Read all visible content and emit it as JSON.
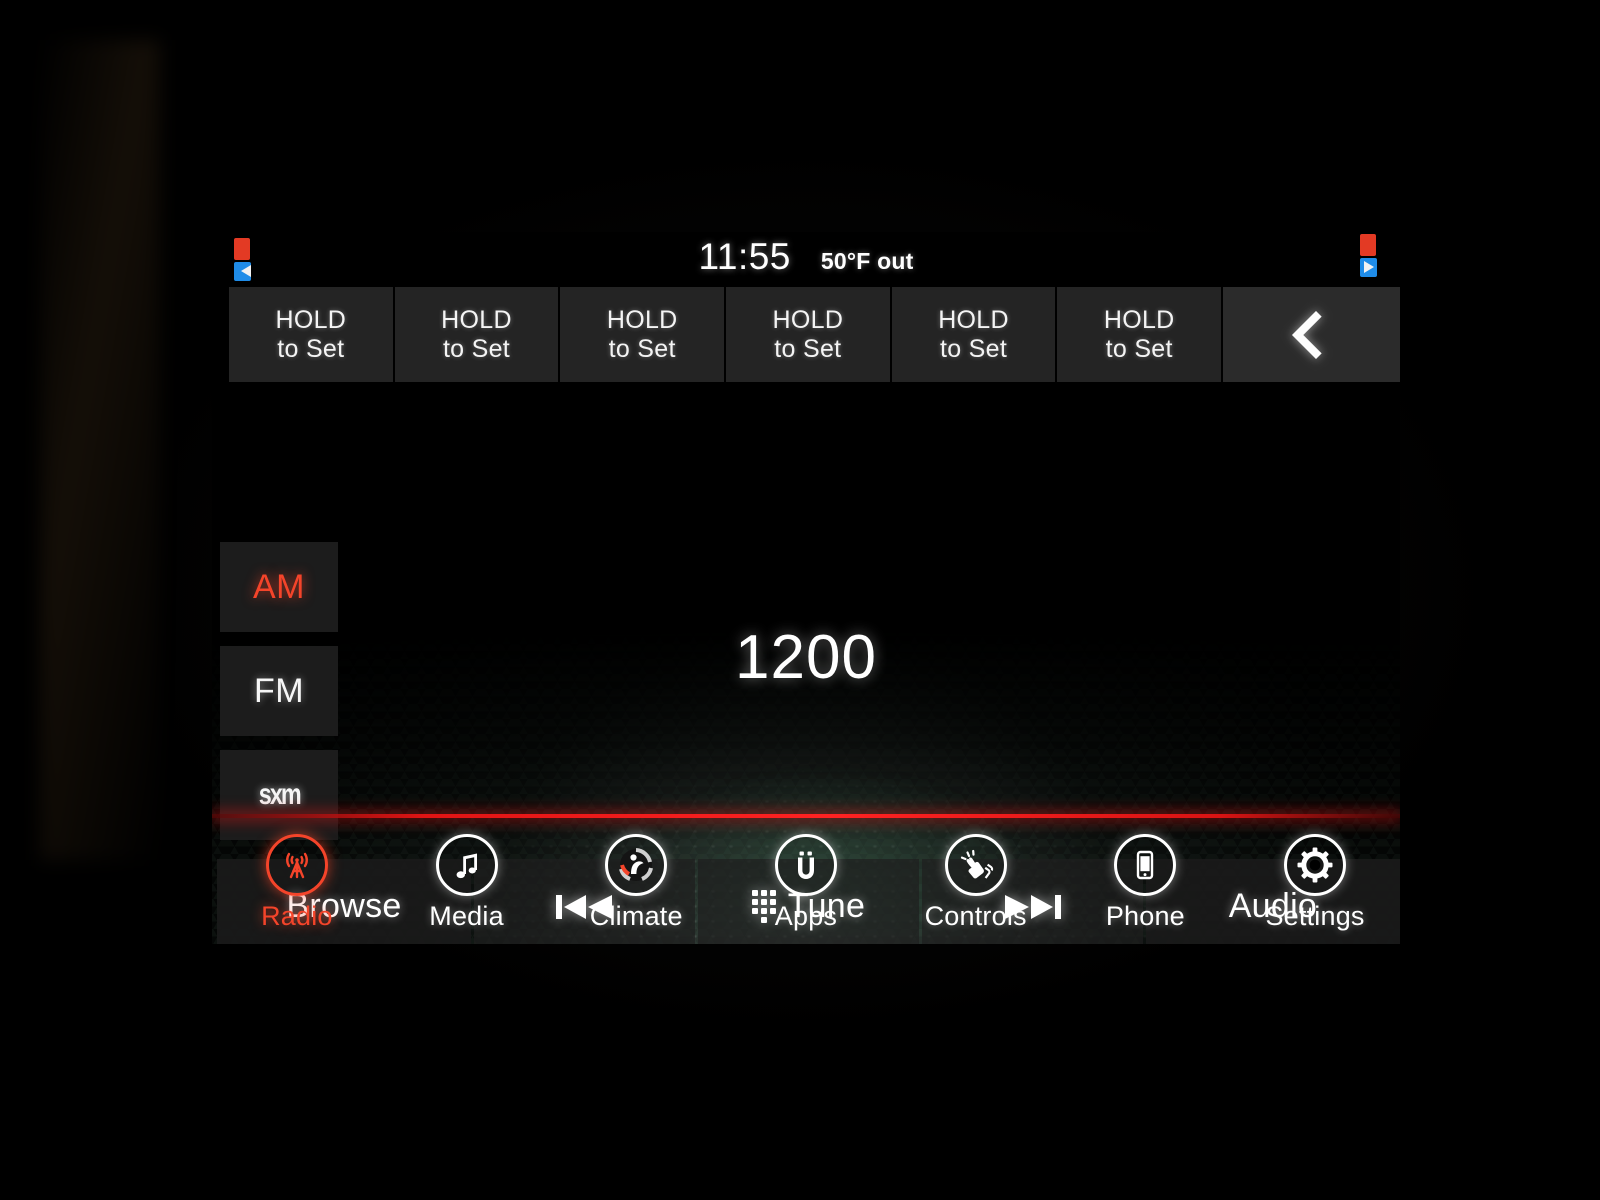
{
  "statusbar": {
    "clock": "11:55",
    "temperature": "50°F out",
    "left_icon": "media-indicator-icon",
    "right_icon": "media-indicator-icon"
  },
  "presets": {
    "buttons": [
      {
        "line1": "HOLD",
        "line2": "to Set"
      },
      {
        "line1": "HOLD",
        "line2": "to Set"
      },
      {
        "line1": "HOLD",
        "line2": "to Set"
      },
      {
        "line1": "HOLD",
        "line2": "to Set"
      },
      {
        "line1": "HOLD",
        "line2": "to Set"
      },
      {
        "line1": "HOLD",
        "line2": "to Set"
      }
    ],
    "back_icon": "chevron-left-icon"
  },
  "bands": {
    "items": [
      {
        "label": "AM",
        "active": true
      },
      {
        "label": "FM",
        "active": false
      },
      {
        "label": "sxm",
        "active": false
      }
    ],
    "active_color": "#f4442a"
  },
  "now_playing": {
    "frequency": "1200"
  },
  "transport": {
    "browse_label": "Browse",
    "prev_icon": "skip-previous-icon",
    "tune_label": "Tune",
    "tune_icon": "keypad-icon",
    "next_icon": "skip-next-icon",
    "audio_label": "Audio"
  },
  "navbar": {
    "accent_color": "#f4442a",
    "items": [
      {
        "label": "Radio",
        "icon": "radio-tower-icon",
        "active": true
      },
      {
        "label": "Media",
        "icon": "music-note-icon",
        "active": false
      },
      {
        "label": "Climate",
        "icon": "climate-seat-icon",
        "active": false
      },
      {
        "label": "Apps",
        "icon": "uconnect-apps-icon",
        "active": false
      },
      {
        "label": "Controls",
        "icon": "hand-controls-icon",
        "active": false
      },
      {
        "label": "Phone",
        "icon": "smartphone-icon",
        "active": false
      },
      {
        "label": "Settings",
        "icon": "gear-icon",
        "active": false
      }
    ]
  }
}
